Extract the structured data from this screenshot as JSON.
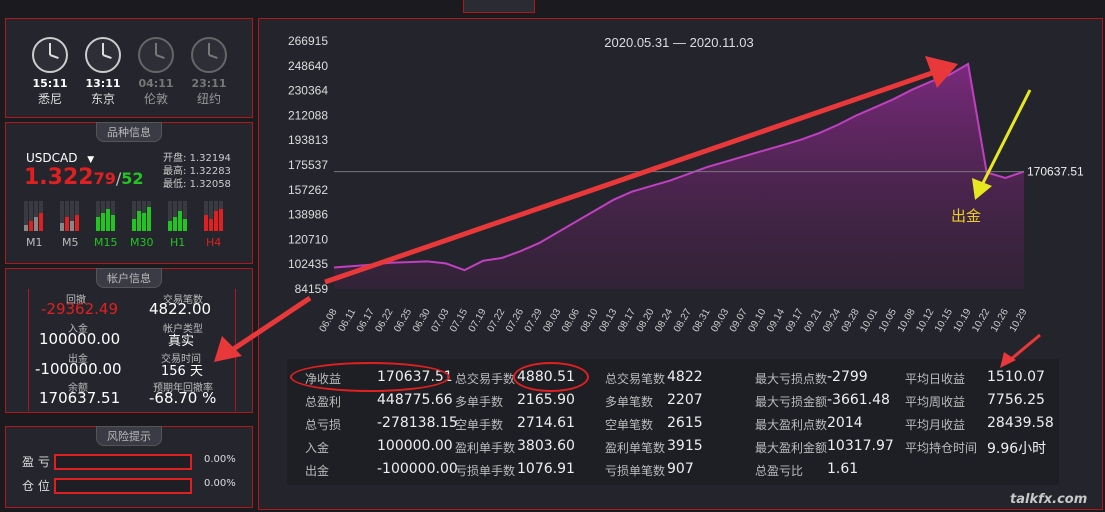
{
  "clocks": [
    {
      "time": "15:11",
      "city": "悉尼",
      "active": true
    },
    {
      "time": "13:11",
      "city": "东京",
      "active": true
    },
    {
      "time": "04:11",
      "city": "伦敦",
      "active": false
    },
    {
      "time": "23:11",
      "city": "纽约",
      "active": false
    }
  ],
  "symbol": {
    "section_title": "品种信息",
    "name": "USDCAD",
    "price_main": "1.322",
    "price_bid": "79",
    "price_sep": "/",
    "price_ask": "52",
    "open_label": "开盘:",
    "open": "1.32194",
    "high_label": "最高:",
    "high": "1.32283",
    "low_label": "最低:",
    "low": "1.32058",
    "timeframes": [
      {
        "label": "M1",
        "color": "#bbbbbb"
      },
      {
        "label": "M5",
        "color": "#bbbbbb"
      },
      {
        "label": "M15",
        "color": "#22c422"
      },
      {
        "label": "M30",
        "color": "#22c422"
      },
      {
        "label": "H1",
        "color": "#22c422"
      },
      {
        "label": "H4",
        "color": "#e02020"
      }
    ]
  },
  "account": {
    "section_title": "帐户信息",
    "drawdown_label": "回撤",
    "drawdown": "-29362.49",
    "trades_label": "交易笔数",
    "trades": "4822.00",
    "deposit_label": "入金",
    "deposit": "100000.00",
    "type_label": "帐户类型",
    "type": "真实",
    "withdraw_label": "出金",
    "withdraw": "-100000.00",
    "time_label": "交易时间",
    "time": "156 天",
    "balance_label": "余额",
    "balance": "170637.51",
    "annual_label": "预期年回撤率",
    "annual": "-68.70 %"
  },
  "risk": {
    "section_title": "风险提示",
    "rows": [
      {
        "label": "盈 亏",
        "value": "0.00%"
      },
      {
        "label": "仓 位",
        "value": "0.00%"
      }
    ]
  },
  "chart_data": {
    "type": "area",
    "title": "2020.05.31 — 2020.11.03",
    "yticks": [
      "266915",
      "248640",
      "230364",
      "212088",
      "193813",
      "175537",
      "157262",
      "138986",
      "120710",
      "102435",
      "84159"
    ],
    "ylim": [
      84159,
      266915
    ],
    "xticks": [
      "06.08",
      "06.11",
      "06.17",
      "06.22",
      "06.25",
      "06.30",
      "07.03",
      "07.15",
      "07.19",
      "07.22",
      "07.26",
      "07.29",
      "08.03",
      "08.06",
      "08.10",
      "08.13",
      "08.17",
      "08.20",
      "08.24",
      "08.27",
      "08.31",
      "09.03",
      "09.07",
      "09.10",
      "09.14",
      "09.17",
      "09.21",
      "09.24",
      "09.28",
      "10.01",
      "10.05",
      "10.08",
      "10.12",
      "10.15",
      "10.19",
      "10.22",
      "10.26",
      "10.29"
    ],
    "series": [
      {
        "values": [
          100000,
          101000,
          102000,
          103500,
          104000,
          104500,
          103000,
          98000,
          105000,
          107000,
          112000,
          118000,
          126000,
          134000,
          142000,
          150000,
          156000,
          160000,
          164000,
          169000,
          174000,
          178000,
          182000,
          186000,
          190000,
          194000,
          199000,
          205000,
          212000,
          218000,
          224000,
          231000,
          237000,
          242000,
          250000,
          170000,
          166000,
          170637.51
        ]
      }
    ],
    "last_value": "170637.51",
    "annotation": "出金",
    "line_color": "#c040c0"
  },
  "stats": [
    [
      {
        "label": "净收益",
        "value": "170637.51"
      },
      {
        "label": "总盈利",
        "value": "448775.66"
      },
      {
        "label": "总亏损",
        "value": "-278138.15"
      },
      {
        "label": "入金",
        "value": "100000.00"
      },
      {
        "label": "出金",
        "value": "-100000.00"
      }
    ],
    [
      {
        "label": "总交易手数",
        "value": "4880.51"
      },
      {
        "label": "多单手数",
        "value": "2165.90"
      },
      {
        "label": "空单手数",
        "value": "2714.61"
      },
      {
        "label": "盈利单手数",
        "value": "3803.60"
      },
      {
        "label": "亏损单手数",
        "value": "1076.91"
      }
    ],
    [
      {
        "label": "总交易笔数",
        "value": "4822"
      },
      {
        "label": "多单笔数",
        "value": "2207"
      },
      {
        "label": "空单笔数",
        "value": "2615"
      },
      {
        "label": "盈利单笔数",
        "value": "3915"
      },
      {
        "label": "亏损单笔数",
        "value": "907"
      }
    ],
    [
      {
        "label": "最大亏损点数",
        "value": "-2799"
      },
      {
        "label": "最大亏损金额",
        "value": "-3661.48"
      },
      {
        "label": "最大盈利点数",
        "value": "2014"
      },
      {
        "label": "最大盈利金额",
        "value": "10317.97"
      },
      {
        "label": "总盈亏比",
        "value": "1.61"
      }
    ],
    [
      {
        "label": "平均日收益",
        "value": "1510.07"
      },
      {
        "label": "平均周收益",
        "value": "7756.25"
      },
      {
        "label": "平均月收益",
        "value": "28439.58"
      },
      {
        "label": "平均持仓时间",
        "value": "9.96小时"
      }
    ]
  ],
  "watermark": "talkfx.com"
}
